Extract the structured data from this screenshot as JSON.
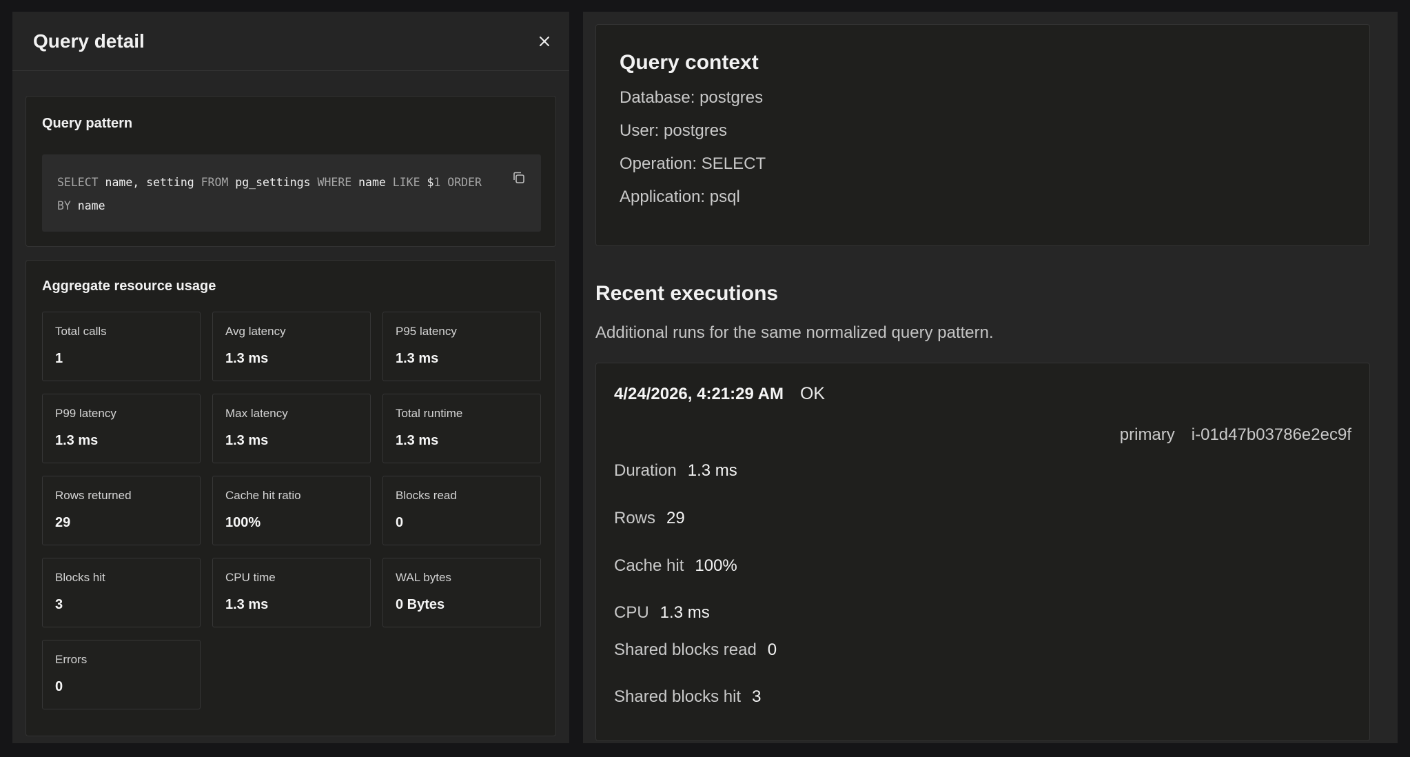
{
  "header": {
    "title": "Query detail"
  },
  "pattern": {
    "title": "Query pattern",
    "tokens": [
      {
        "text": "SELECT",
        "kw": true
      },
      {
        "text": " name, setting ",
        "kw": false
      },
      {
        "text": "FROM",
        "kw": true
      },
      {
        "text": " pg_settings ",
        "kw": false
      },
      {
        "text": "WHERE",
        "kw": true
      },
      {
        "text": " name ",
        "kw": false
      },
      {
        "text": "LIKE",
        "kw": true
      },
      {
        "text": " $",
        "kw": false
      },
      {
        "text": "1",
        "kw": true
      },
      {
        "text": " ",
        "kw": false
      },
      {
        "text": "ORDER BY",
        "kw": true
      },
      {
        "text": " name",
        "kw": false
      }
    ]
  },
  "aggregate": {
    "title": "Aggregate resource usage",
    "metrics": [
      {
        "label": "Total calls",
        "value": "1"
      },
      {
        "label": "Avg latency",
        "value": "1.3 ms"
      },
      {
        "label": "P95 latency",
        "value": "1.3 ms"
      },
      {
        "label": "P99 latency",
        "value": "1.3 ms"
      },
      {
        "label": "Max latency",
        "value": "1.3 ms"
      },
      {
        "label": "Total runtime",
        "value": "1.3 ms"
      },
      {
        "label": "Rows returned",
        "value": "29"
      },
      {
        "label": "Cache hit ratio",
        "value": "100%"
      },
      {
        "label": "Blocks read",
        "value": "0"
      },
      {
        "label": "Blocks hit",
        "value": "3"
      },
      {
        "label": "CPU time",
        "value": "1.3 ms"
      },
      {
        "label": "WAL bytes",
        "value": "0 Bytes"
      },
      {
        "label": "Errors",
        "value": "0"
      }
    ]
  },
  "context": {
    "title": "Query context",
    "lines": [
      "Database: postgres",
      "User: postgres",
      "Operation: SELECT",
      "Application: psql"
    ]
  },
  "recent": {
    "title": "Recent executions",
    "subtitle": "Additional runs for the same normalized query pattern.",
    "execution": {
      "time": "4/24/2026, 4:21:29 AM",
      "status": "OK",
      "role": "primary",
      "instance": "i-01d47b03786e2ec9f",
      "fields": [
        {
          "k": "Duration",
          "v": "1.3 ms"
        },
        {
          "k": "Rows",
          "v": "29"
        },
        {
          "k": "Cache hit",
          "v": "100%"
        },
        {
          "k": "CPU",
          "v": "1.3 ms"
        },
        {
          "k": "Shared blocks read",
          "v": "0"
        },
        {
          "k": "Shared blocks hit",
          "v": "3"
        }
      ]
    }
  }
}
